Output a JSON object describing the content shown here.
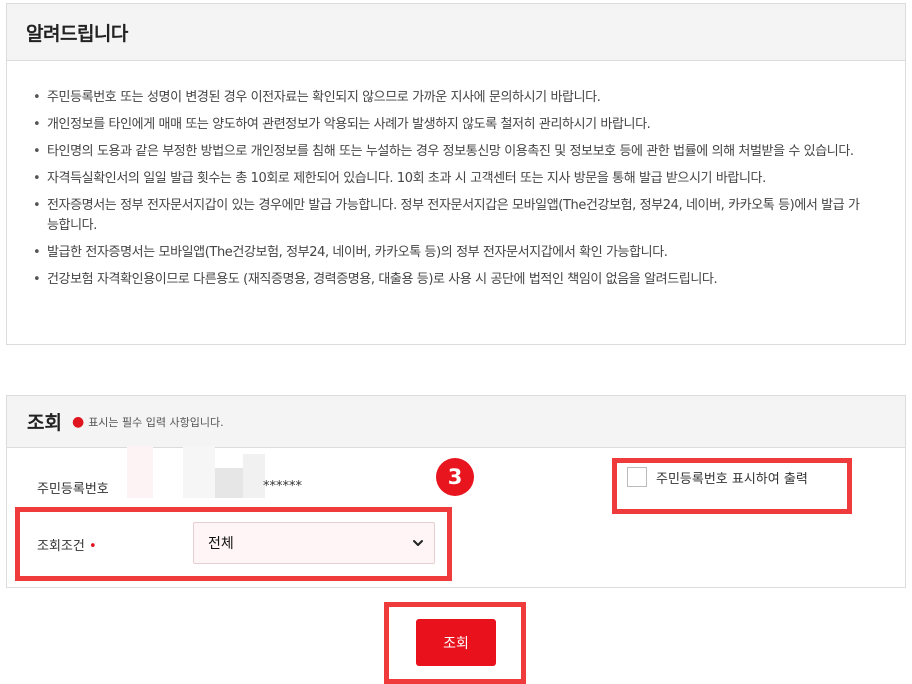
{
  "notice": {
    "title": "알려드립니다",
    "items": [
      "주민등록번호 또는 성명이 변경된 경우 이전자료는 확인되지 않으므로 가까운 지사에 문의하시기 바랍니다.",
      "개인정보를 타인에게 매매 또는 양도하여 관련정보가 악용되는 사례가 발생하지 않도록 철저히 관리하시기 바랍니다.",
      "타인명의 도용과 같은 부정한 방법으로 개인정보를 침해 또는 누설하는 경우 정보통신망 이용촉진 및 정보보호 등에 관한 법률에 의해 처벌받을 수 있습니다.",
      "자격득실확인서의 일일 발급 횟수는 총 10회로 제한되어 있습니다. 10회 초과 시 고객센터 또는 지사 방문을 통해 발급 받으시기 바랍니다.",
      "전자증명서는 정부 전자문서지갑이 있는 경우에만 발급 가능합니다. 정부 전자문서지갑은 모바일앱(The건강보험, 정부24, 네이버, 카카오톡 등)에서 발급 가능합니다.",
      "발급한 전자증명서는 모바일앱(The건강보험, 정부24, 네이버, 카카오톡 등)의 정부 전자문서지갑에서 확인 가능합니다.",
      "건강보험 자격확인용이므로 다른용도 (재직증명용, 경력증명용, 대출용 등)로 사용 시 공단에 법적인 책임이 없음을 알려드립니다."
    ]
  },
  "query": {
    "title": "조회",
    "required_note": "표시는 필수 입력 사항입니다.",
    "rrn_label": "주민등록번호",
    "rrn_masked": "******",
    "show_rrn_checkbox_label": "주민등록번호 표시하여 출력",
    "show_rrn_checked": false,
    "condition_label": "조회조건",
    "condition_value": "전체",
    "submit_label": "조회"
  },
  "annotation": {
    "step_number": "3"
  },
  "colors": {
    "accent_red": "#e8111c",
    "annotation_red": "#ef3b3b",
    "header_bg": "#f4f4f4",
    "select_bg": "#fff5f6"
  }
}
